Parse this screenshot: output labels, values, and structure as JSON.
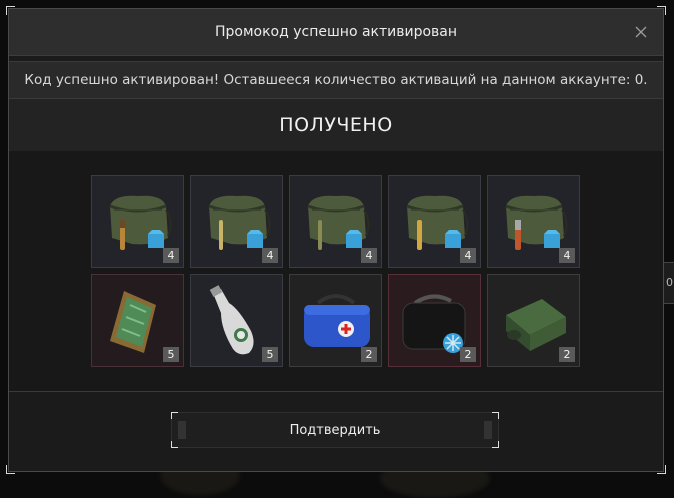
{
  "dialog": {
    "title": "Промокод успешно активирован",
    "message": "Код успешно активирован! Оставшееся количество активаций на данном аккаунте: 0.",
    "received_label": "ПОЛУЧЕНО",
    "confirm_label": "Подтвердить",
    "close_icon": "close-icon"
  },
  "background": {
    "edge_text": "0"
  },
  "items": [
    {
      "name": "bag-with-armor",
      "qty": "4"
    },
    {
      "name": "bag-with-armor",
      "qty": "4"
    },
    {
      "name": "bag-with-armor",
      "qty": "4"
    },
    {
      "name": "bag-with-armor",
      "qty": "4"
    },
    {
      "name": "bag-with-armor",
      "qty": "4"
    },
    {
      "name": "ration-pack",
      "qty": "5"
    },
    {
      "name": "bottle",
      "qty": "5"
    },
    {
      "name": "blue-medkit",
      "qty": "2"
    },
    {
      "name": "black-medkit",
      "qty": "2"
    },
    {
      "name": "ammo-crate",
      "qty": "2"
    }
  ],
  "colors": {
    "accent_blue": "#3aa0d8",
    "medkit_blue": "#2c56c9",
    "olive": "#4d5a3c"
  }
}
